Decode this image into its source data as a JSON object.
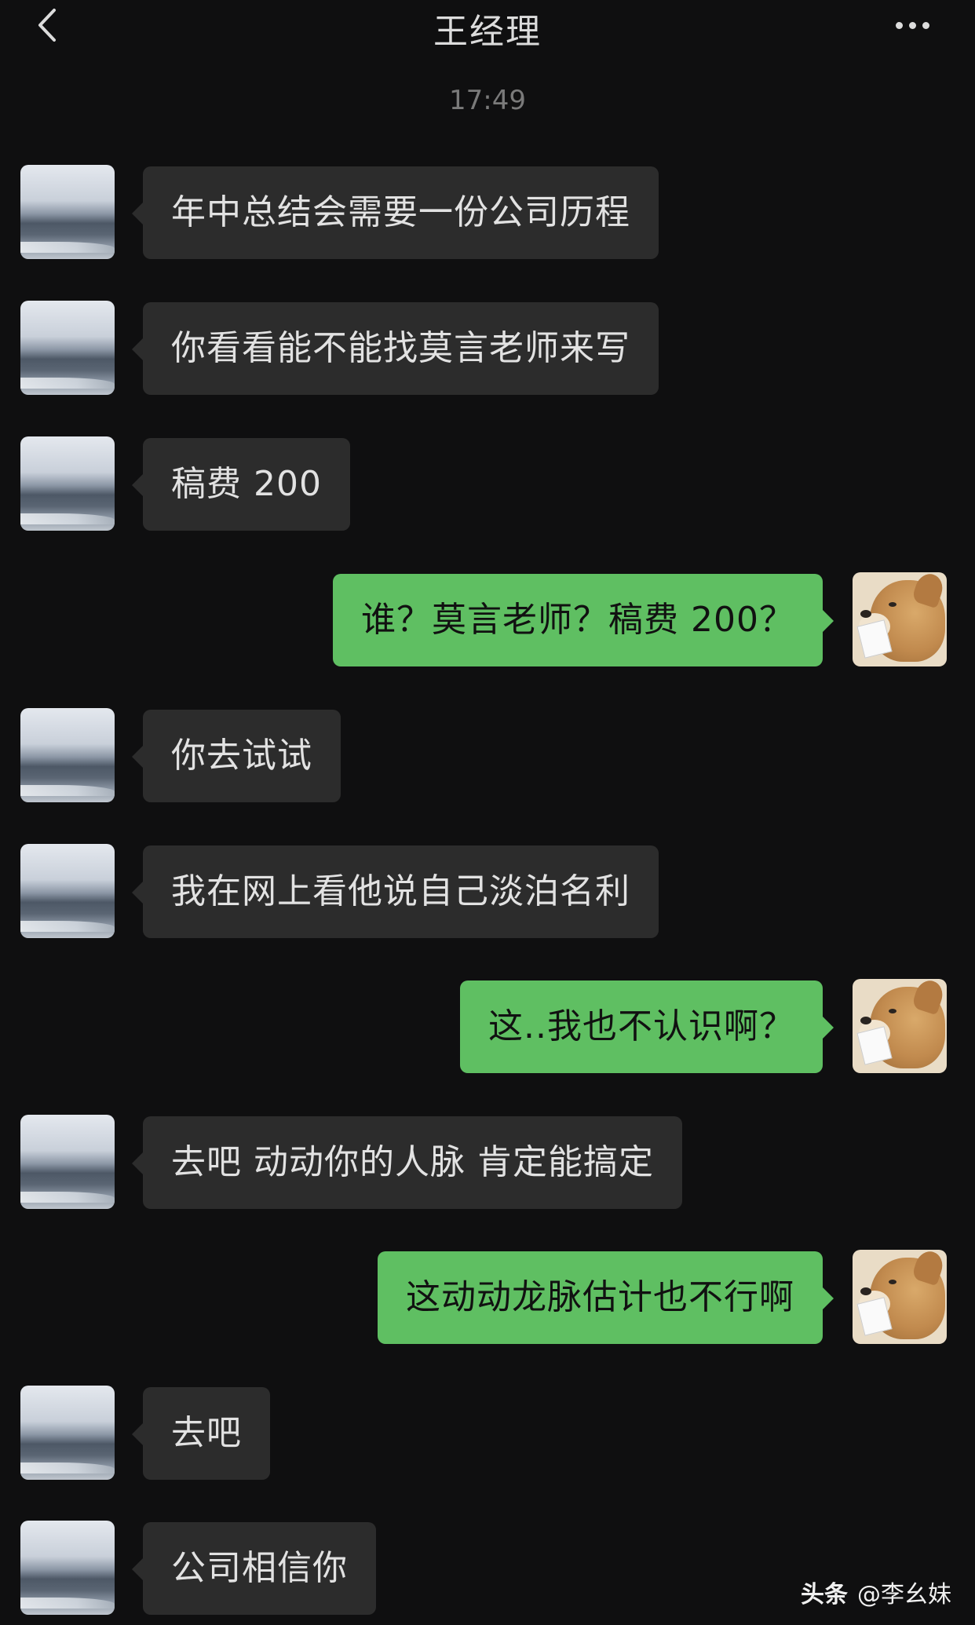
{
  "header": {
    "back_icon": "chevron-left-icon",
    "title": "王经理",
    "more_icon": "more-dots-icon"
  },
  "timestamp": "17:49",
  "messages": [
    {
      "sender": "other",
      "text": "年中总结会需要一份公司历程"
    },
    {
      "sender": "other",
      "text": "你看看能不能找莫言老师来写"
    },
    {
      "sender": "other",
      "text": "稿费 200"
    },
    {
      "sender": "self",
      "text": "谁？莫言老师？稿费 200？"
    },
    {
      "sender": "other",
      "text": "你去试试"
    },
    {
      "sender": "other",
      "text": "我在网上看他说自己淡泊名利"
    },
    {
      "sender": "self",
      "text": "这..我也不认识啊？"
    },
    {
      "sender": "other",
      "text": "去吧 动动你的人脉 肯定能搞定"
    },
    {
      "sender": "self",
      "text": "这动动龙脉估计也不行啊"
    },
    {
      "sender": "other",
      "text": "去吧"
    },
    {
      "sender": "other",
      "text": "公司相信你"
    }
  ],
  "colors": {
    "background": "#0f0f10",
    "incoming_bubble": "#2c2c2c",
    "outgoing_bubble": "#5fbf62"
  },
  "watermark": {
    "brand": "头条",
    "handle": "@李幺妹"
  }
}
